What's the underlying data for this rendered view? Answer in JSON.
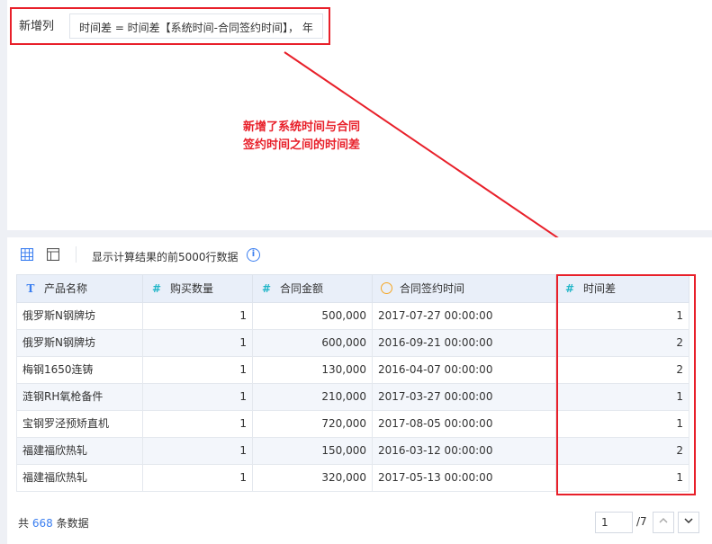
{
  "formula_field": {
    "label": "新增列",
    "value": "时间差 = 时间差【系统时间-合同签约时间】， 年"
  },
  "annotation": {
    "line1": "新增了系统时间与合同",
    "line2": "签约时间之间的时间差"
  },
  "toolbar": {
    "grid_icon": "grid-icon",
    "table_icon": "table-icon",
    "info_text": "显示计算结果的前5000行数据",
    "info_icon": "i"
  },
  "table": {
    "columns": [
      {
        "icon": "T",
        "type": "text",
        "label": "产品名称"
      },
      {
        "icon": "#",
        "type": "number",
        "label": "购买数量"
      },
      {
        "icon": "#",
        "type": "number",
        "label": "合同金额"
      },
      {
        "icon": "clock",
        "type": "date",
        "label": "合同签约时间"
      },
      {
        "icon": "#",
        "type": "number",
        "label": "时间差"
      }
    ],
    "rows": [
      [
        "俄罗斯N钢牌坊",
        "1",
        "500,000",
        "2017-07-27 00:00:00",
        "1"
      ],
      [
        "俄罗斯N钢牌坊",
        "1",
        "600,000",
        "2016-09-21 00:00:00",
        "2"
      ],
      [
        "梅钢1650连铸",
        "1",
        "130,000",
        "2016-04-07 00:00:00",
        "2"
      ],
      [
        "涟钢RH氧枪备件",
        "1",
        "210,000",
        "2017-03-27 00:00:00",
        "1"
      ],
      [
        "宝钢罗泾预矫直机",
        "1",
        "720,000",
        "2017-08-05 00:00:00",
        "1"
      ],
      [
        "福建福欣热轧",
        "1",
        "150,000",
        "2016-03-12 00:00:00",
        "2"
      ],
      [
        "福建福欣热轧",
        "1",
        "320,000",
        "2017-05-13 00:00:00",
        "1"
      ]
    ]
  },
  "footer": {
    "prefix": "共",
    "count": "668",
    "suffix": "条数据",
    "page": "1",
    "total_pages": "/7"
  }
}
